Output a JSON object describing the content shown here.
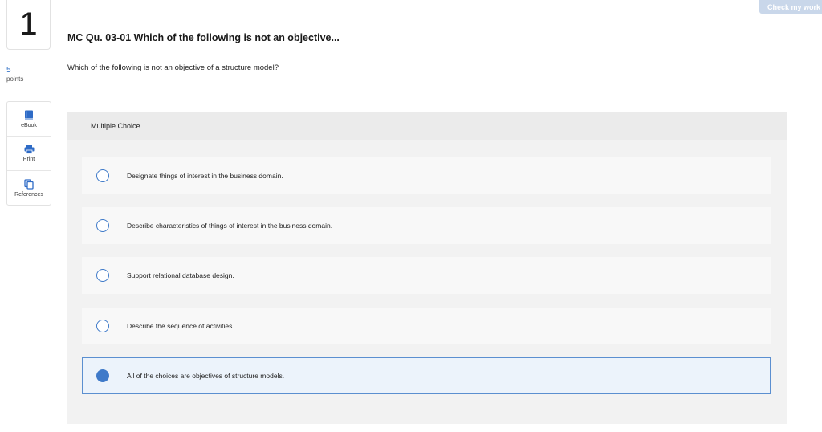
{
  "question": {
    "number": "1",
    "points_value": "5",
    "points_label": "points",
    "title": "MC Qu. 03-01 Which of the following is not an objective...",
    "prompt": "Which of the following is not an objective of a structure model?"
  },
  "toolbar": {
    "check_label": "Check my work"
  },
  "tools": [
    {
      "label": "eBook",
      "icon": "book-icon"
    },
    {
      "label": "Print",
      "icon": "printer-icon"
    },
    {
      "label": "References",
      "icon": "copy-icon"
    }
  ],
  "answer": {
    "type_label": "Multiple Choice",
    "options": [
      {
        "text": "Designate things of interest in the business domain.",
        "selected": false
      },
      {
        "text": "Describe characteristics of things of interest in the business domain.",
        "selected": false
      },
      {
        "text": "Support relational database design.",
        "selected": false
      },
      {
        "text": "Describe the sequence of activities.",
        "selected": false
      },
      {
        "text": "All of the choices are objectives of structure models.",
        "selected": true
      }
    ]
  },
  "colors": {
    "accent": "#3f7ac9",
    "selected_bg": "#ecf3fb",
    "check_button": "#c9d7ea"
  }
}
